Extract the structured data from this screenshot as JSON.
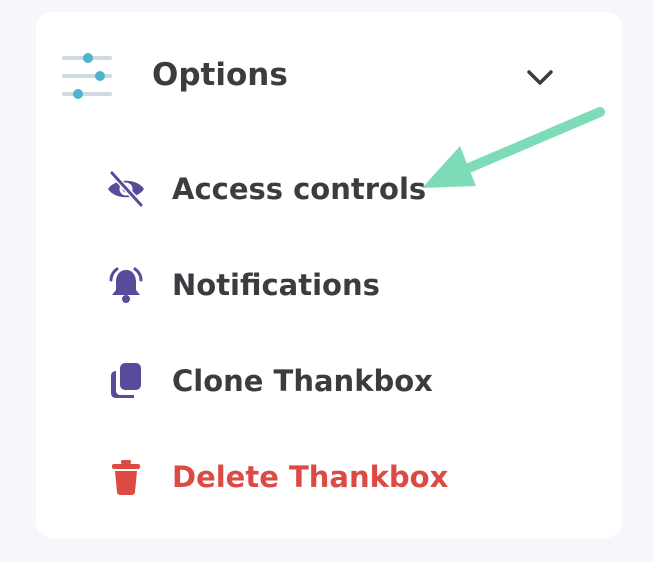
{
  "header": {
    "title": "Options",
    "icon": "sliders-icon",
    "chevron": "chevron-down-icon"
  },
  "menu": {
    "items": [
      {
        "label": "Access controls",
        "icon": "eye-slash-icon",
        "color": "#3b3c40"
      },
      {
        "label": "Notifications",
        "icon": "bell-ringing-icon",
        "color": "#3b3c40"
      },
      {
        "label": "Clone Thankbox",
        "icon": "copy-icon",
        "color": "#3b3c40"
      },
      {
        "label": "Delete Thankbox",
        "icon": "trash-icon",
        "color": "#dd4a43"
      }
    ]
  },
  "colors": {
    "icon_purple": "#5a4a9b",
    "danger_red": "#dd4a43",
    "arrow_green": "#7ddcb7",
    "slider_blue": "#4cb5ce",
    "slider_track": "#cfd9e0"
  }
}
